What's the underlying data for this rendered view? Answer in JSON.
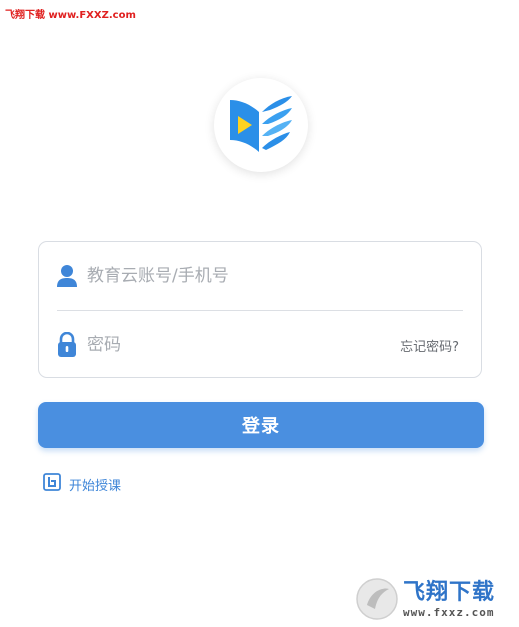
{
  "watermark_top": "飞翔下载 www.FXXZ.com",
  "login": {
    "account_placeholder": "教育云账号/手机号",
    "password_placeholder": "密码",
    "forgot_label": "忘记密码?",
    "submit_label": "登录"
  },
  "start_class_label": "开始授课",
  "watermark_bottom": {
    "title": "飞翔下载",
    "url": "www.fxxz.com"
  },
  "colors": {
    "primary": "#4a8fe0",
    "icon_blue": "#3f86d8",
    "watermark_red": "#e0201f"
  },
  "icons": {
    "account": "user-icon",
    "password": "lock-icon",
    "start_class": "start-class-icon",
    "logo": "app-logo-book-play"
  }
}
